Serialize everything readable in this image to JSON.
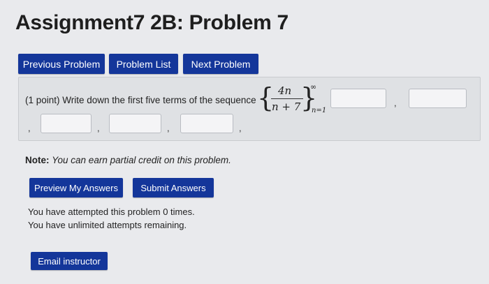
{
  "page": {
    "title": "Assignment7 2B: Problem 7"
  },
  "nav": {
    "previous_label": "Previous Problem",
    "list_label": "Problem List",
    "next_label": "Next Problem"
  },
  "problem": {
    "prompt": "(1 point) Write down the first five terms of the sequence",
    "sequence": {
      "numerator": "4n",
      "denominator": "n + 7",
      "upper_limit": "∞",
      "lower_limit": "n=1"
    },
    "answers": [
      {
        "value": "",
        "placeholder": ""
      },
      {
        "value": "",
        "placeholder": ""
      },
      {
        "value": "",
        "placeholder": ""
      },
      {
        "value": "",
        "placeholder": ""
      },
      {
        "value": "",
        "placeholder": ""
      }
    ],
    "separator": ","
  },
  "note": {
    "label": "Note:",
    "text": "You can earn partial credit on this problem."
  },
  "actions": {
    "preview_label": "Preview My Answers",
    "submit_label": "Submit Answers"
  },
  "status": {
    "attempts": "You have attempted this problem 0 times.",
    "remaining": "You have unlimited attempts remaining."
  },
  "footer": {
    "email_label": "Email instructor"
  },
  "colors": {
    "button_bg": "#14369a",
    "page_bg": "#e9eaed",
    "box_bg": "#dfe1e4"
  }
}
